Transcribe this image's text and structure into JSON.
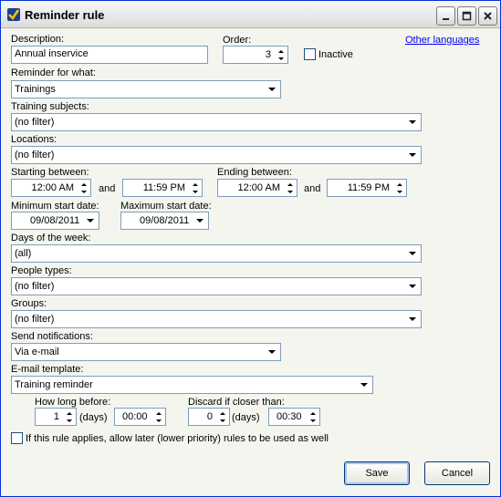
{
  "window": {
    "title": "Reminder rule"
  },
  "description": {
    "label": "Description:",
    "value": "Annual inservice"
  },
  "order": {
    "label": "Order:",
    "value": "3"
  },
  "inactive": {
    "label": "Inactive",
    "checked": false
  },
  "other_languages": {
    "label": "Other languages"
  },
  "reminder_for": {
    "label": "Reminder for what:",
    "value": "Trainings"
  },
  "training_subjects": {
    "label": "Training subjects:",
    "value": "(no filter)"
  },
  "locations": {
    "label": "Locations:",
    "value": "(no filter)"
  },
  "starting_between": {
    "label": "Starting between:",
    "from": "12:00 AM",
    "and": "and",
    "to": "11:59 PM"
  },
  "ending_between": {
    "label": "Ending between:",
    "from": "12:00 AM",
    "and": "and",
    "to": "11:59 PM"
  },
  "min_start_date": {
    "label": "Minimum start date:",
    "value": "09/08/2011"
  },
  "max_start_date": {
    "label": "Maximum start date:",
    "value": "09/08/2011"
  },
  "days_of_week": {
    "label": "Days of the week:",
    "value": "(all)"
  },
  "people_types": {
    "label": "People types:",
    "value": "(no filter)"
  },
  "groups": {
    "label": "Groups:",
    "value": "(no filter)"
  },
  "send_notifications": {
    "label": "Send notifications:",
    "value": "Via e-mail"
  },
  "email_template": {
    "label": "E-mail template:",
    "value": "Training reminder"
  },
  "how_long_before": {
    "label": "How long before:",
    "days_value": "1",
    "days_unit": "(days)",
    "time_value": "00:00"
  },
  "discard_if_closer": {
    "label": "Discard if closer than:",
    "days_value": "0",
    "days_unit": "(days)",
    "time_value": "00:30"
  },
  "allow_later_rules": {
    "label": "If this rule applies, allow later (lower priority) rules to be used as well",
    "checked": false
  },
  "buttons": {
    "save": "Save",
    "cancel": "Cancel"
  },
  "colors": {
    "titlebar_border": "#0831d9",
    "input_border": "#7f9db9",
    "link": "#0000ee"
  }
}
